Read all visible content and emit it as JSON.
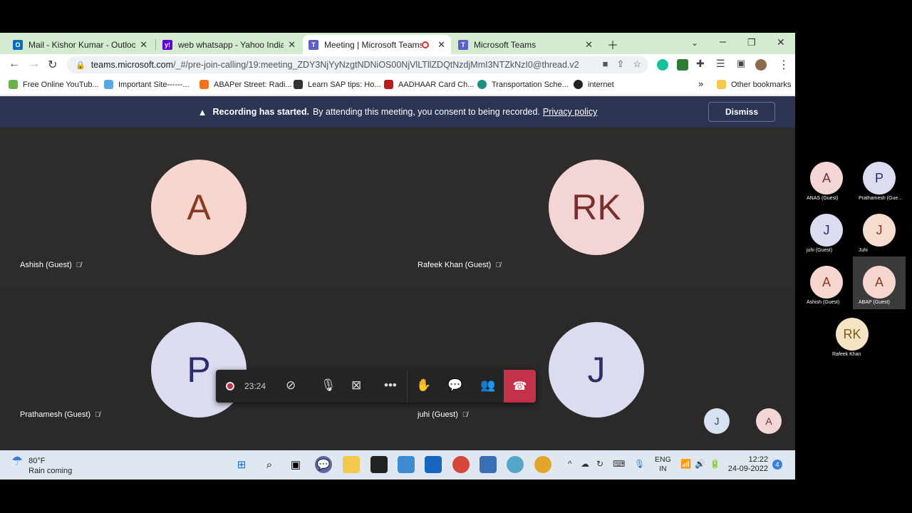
{
  "browser": {
    "tabs": [
      {
        "label": "Mail - Kishor Kumar - Outlook",
        "icon": "outlook-icon",
        "color": "#0f6cbd"
      },
      {
        "label": "web whatsapp - Yahoo India Sea",
        "icon": "yahoo-icon",
        "color": "#6001d2"
      },
      {
        "label": "Meeting | Microsoft Teams",
        "icon": "teams-icon",
        "color": "#5b5fc7"
      },
      {
        "label": "Microsoft Teams",
        "icon": "teams-icon",
        "color": "#5b5fc7"
      }
    ],
    "url_host": "teams.microsoft.com",
    "url_path": "/_#/pre-join-calling/19:meeting_ZDY3NjYyNzgtNDNiOS00NjVlLTllZDQtNzdjMmI3NTZkNzI0@thread.v2",
    "bookmarks": [
      {
        "label": "Free Online YouTub...",
        "color": "#6ab04c"
      },
      {
        "label": "Important Site------...",
        "color": "#5da7e0"
      },
      {
        "label": "ABAPer Street: Radi...",
        "color": "#f0731f"
      },
      {
        "label": "Learn SAP tips: Ho...",
        "color": "#333333"
      },
      {
        "label": "AADHAAR Card Ch...",
        "color": "#b91c1c"
      },
      {
        "label": "Transportation Sche...",
        "color": "#1f8f80"
      },
      {
        "label": "internet",
        "color": "#222222"
      }
    ],
    "bookmarks_more": "»",
    "other_bookmarks": "Other bookmarks"
  },
  "banner": {
    "bold": "Recording has started.",
    "text": "By attending this meeting, you consent to being recorded.",
    "link": "Privacy policy",
    "dismiss": "Dismiss"
  },
  "participants": [
    {
      "initials": "A",
      "name": "Ashish (Guest)",
      "bg": "#f6d6cf",
      "fg": "#8a3a22"
    },
    {
      "initials": "RK",
      "name": "Rafeek Khan (Guest)",
      "bg": "#f3d5d5",
      "fg": "#7a2f2f"
    },
    {
      "initials": "P",
      "name": "Prathamesh (Guest)",
      "bg": "#dcdcf0",
      "fg": "#2b2d6b"
    },
    {
      "initials": "J",
      "name": "juhi (Guest)",
      "bg": "#dcdcf0",
      "fg": "#2b2d6b"
    }
  ],
  "callbar": {
    "timer": "23:24"
  },
  "overflow": [
    {
      "initials": "J",
      "bg": "#d6e2f0",
      "fg": "#2b3d6b"
    },
    {
      "initials": "A",
      "bg": "#f3d5d5",
      "fg": "#7a2f2f"
    }
  ],
  "roster": [
    {
      "initials": "A",
      "name": "ANAS (Guest)",
      "bg": "#f3d5d5",
      "fg": "#7a2f2f"
    },
    {
      "initials": "P",
      "name": "Prathamesh (Gue...",
      "bg": "#dcdcf0",
      "fg": "#2b2d6b"
    },
    {
      "initials": "J",
      "name": "juhi (Guest)",
      "bg": "#dcdcf0",
      "fg": "#2b2d6b"
    },
    {
      "initials": "J",
      "name": "Juhi",
      "bg": "#f6dccf",
      "fg": "#8a3a22"
    },
    {
      "initials": "A",
      "name": "Ashish (Guest)",
      "bg": "#f6d6cf",
      "fg": "#8a3a22"
    },
    {
      "initials": "A",
      "name": "ABAP (Guest)",
      "bg": "#f6d6cf",
      "fg": "#8a3a22"
    },
    {
      "initials": "RK",
      "name": "Rafeek Khan",
      "bg": "#f4e4c4",
      "fg": "#7a5a1f"
    }
  ],
  "taskbar": {
    "temp": "80°F",
    "weather": "Rain coming",
    "lang1": "ENG",
    "lang2": "IN",
    "time": "12:22",
    "date": "24-09-2022",
    "notifications": "4"
  }
}
